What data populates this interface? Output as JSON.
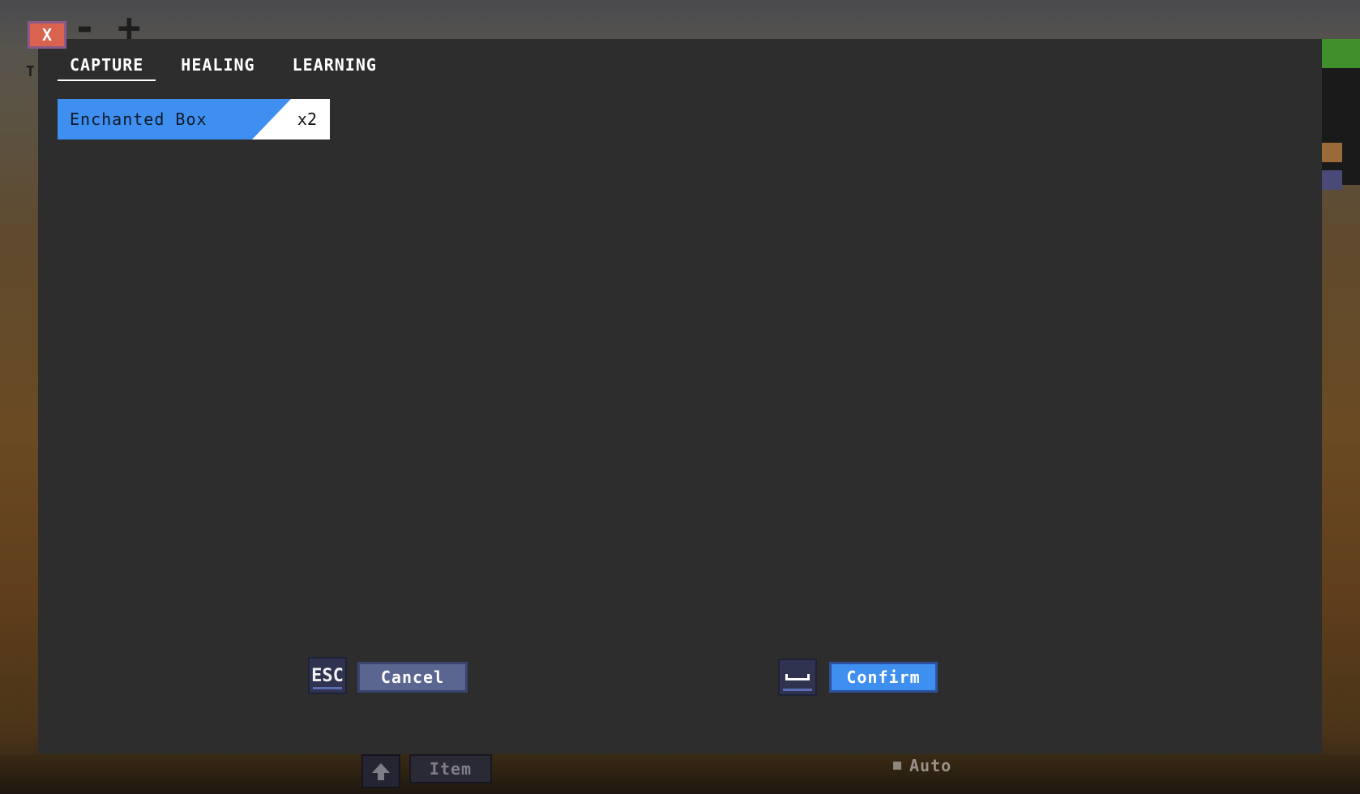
{
  "window": {
    "close_label": "X"
  },
  "background": {
    "glyphs": [
      "-",
      "+"
    ],
    "corner_letter": "T"
  },
  "tabs": [
    {
      "label": "CAPTURE",
      "active": true
    },
    {
      "label": "HEALING",
      "active": false
    },
    {
      "label": "LEARNING",
      "active": false
    }
  ],
  "items": [
    {
      "name": "Enchanted Box",
      "quantity": "x2"
    }
  ],
  "footer": {
    "cancel_key": "ESC",
    "cancel_label": "Cancel",
    "confirm_key": "space-icon",
    "confirm_label": "Confirm"
  },
  "hud": {
    "item_label": "Item",
    "auto_label": "Auto"
  },
  "colors": {
    "accent": "#3f8ff0",
    "dialog_bg": "#2d2d2d",
    "close_button": "#d9634f"
  }
}
